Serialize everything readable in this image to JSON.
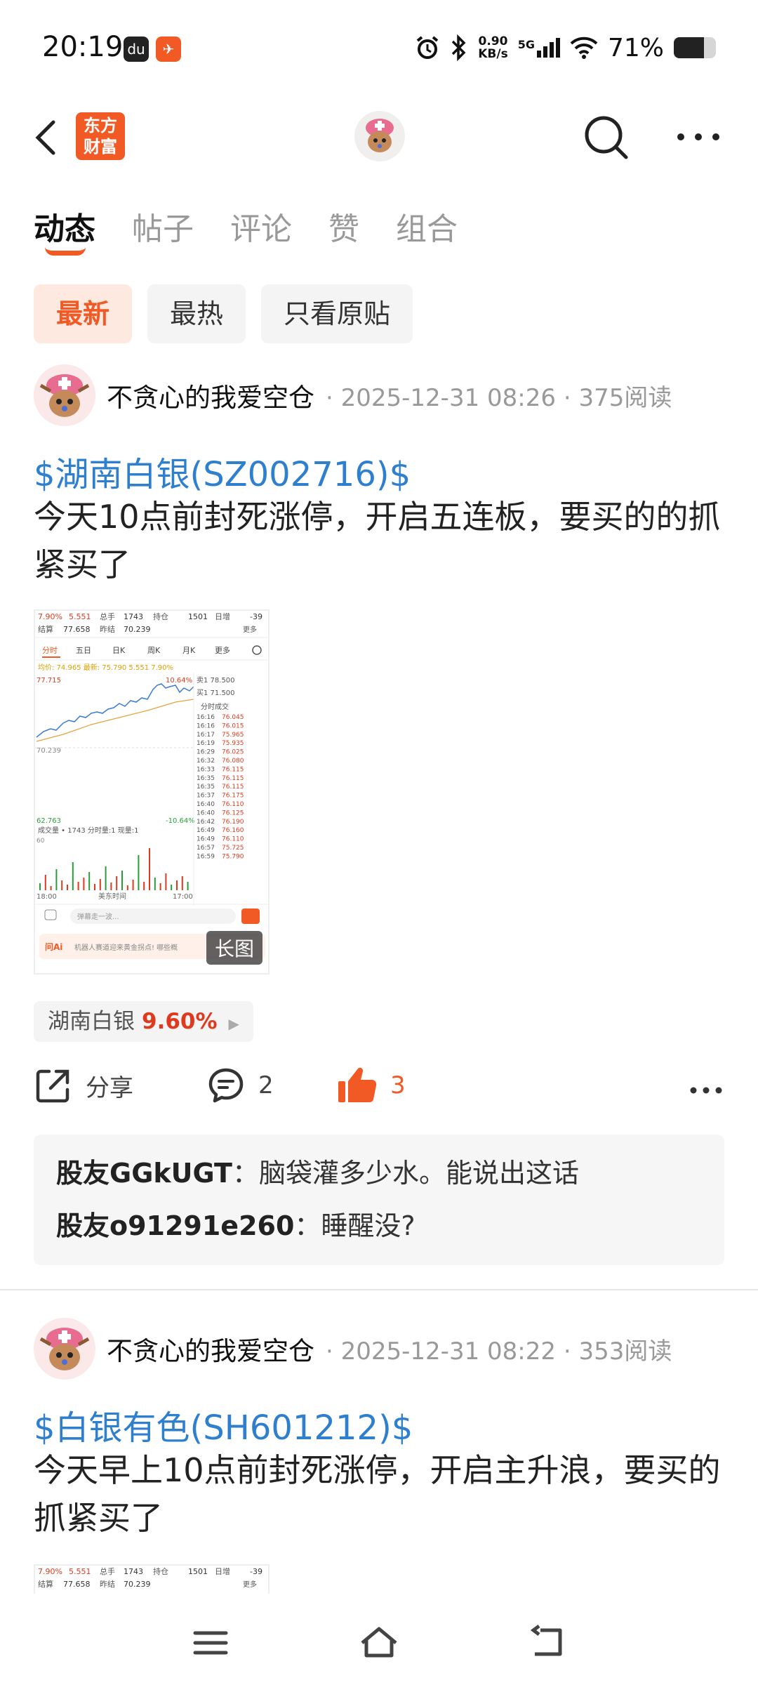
{
  "status": {
    "time": "20:19",
    "net_speed_top": "0.90",
    "net_speed_bottom": "KB/s",
    "network": "5G",
    "battery_text": "71%",
    "battery_level": 0.71
  },
  "header": {
    "logo_line1": "东方",
    "logo_line2": "财富"
  },
  "tabs": [
    {
      "label": "动态",
      "active": true
    },
    {
      "label": "帖子"
    },
    {
      "label": "评论"
    },
    {
      "label": "赞"
    },
    {
      "label": "组合"
    }
  ],
  "filters": [
    {
      "label": "最新",
      "active": true
    },
    {
      "label": "最热"
    },
    {
      "label": "只看原贴"
    }
  ],
  "posts": [
    {
      "author": "不贪心的我爱空仓",
      "time": "2025-12-31 08:26",
      "reads": "375阅读",
      "stock_link": "$湖南白银(SZ002716)$",
      "text": "今天10点前封死涨停，开启五连板，要买的的抓紧买了",
      "image_badge": "长图",
      "stock_tag": "湖南白银",
      "stock_pct": "9.60%",
      "share_label": "分享",
      "comment_count": "2",
      "like_count": "3",
      "comments": [
        {
          "name": "股友GGkUGT",
          "text": "脑袋灌多少水。能说出这话"
        },
        {
          "name": "股友o91291e260",
          "text": "睡醒没?"
        }
      ]
    },
    {
      "author": "不贪心的我爱空仓",
      "time": "2025-12-31 08:22",
      "reads": "353阅读",
      "stock_link": "$白银有色(SH601212)$",
      "text": "今天早上10点前封死涨停，开启主升浪，要买的抓紧买了"
    }
  ],
  "thumb": {
    "r1": [
      "7.90%",
      "5.551",
      "总手",
      "1743",
      "持仓",
      "1501",
      "日增",
      "-39"
    ],
    "r2": [
      "结算",
      "77.658",
      "昨结",
      "70.239",
      "更多"
    ],
    "tabs": [
      "分时",
      "五日",
      "日K",
      "周K",
      "月K",
      "更多"
    ],
    "avg_line": "均价: 74.965 最新: 75.790 5.551 7.90%",
    "price_hi": "77.715",
    "price_mid": "70.239",
    "price_lo": "62.763",
    "pct_hi": "10.64%",
    "pct_lo": "-10.64%",
    "ask": "卖1 78.500",
    "bid": "买1 71.500",
    "ticks_title": "分时成交",
    "ticks": [
      [
        "16:16",
        "76.045"
      ],
      [
        "16:16",
        "76.015"
      ],
      [
        "16:17",
        "75.965"
      ],
      [
        "16:19",
        "75.935"
      ],
      [
        "16:29",
        "76.025"
      ],
      [
        "16:32",
        "76.080"
      ],
      [
        "16:33",
        "76.115"
      ],
      [
        "16:35",
        "76.115"
      ],
      [
        "16:35",
        "76.115"
      ],
      [
        "16:37",
        "76.175"
      ],
      [
        "16:40",
        "76.110"
      ],
      [
        "16:40",
        "76.125"
      ],
      [
        "16:42",
        "76.190"
      ],
      [
        "16:49",
        "76.160"
      ],
      [
        "16:49",
        "76.110"
      ],
      [
        "16:57",
        "75.725"
      ],
      [
        "16:59",
        "75.790"
      ]
    ],
    "vol_label": "成交量 • 1743  分时量:1  现量:1",
    "vol_axis": "60",
    "time_start": "18:00",
    "time_mid": "美东时间",
    "time_end": "17:00",
    "barrage": "弹幕走一波...",
    "ai_text": "机器人赛道迎来黄金拐点! 哪些概"
  },
  "colors": {
    "accent": "#f15a24",
    "link": "#2f7fcf",
    "rise": "#e03a1e"
  }
}
